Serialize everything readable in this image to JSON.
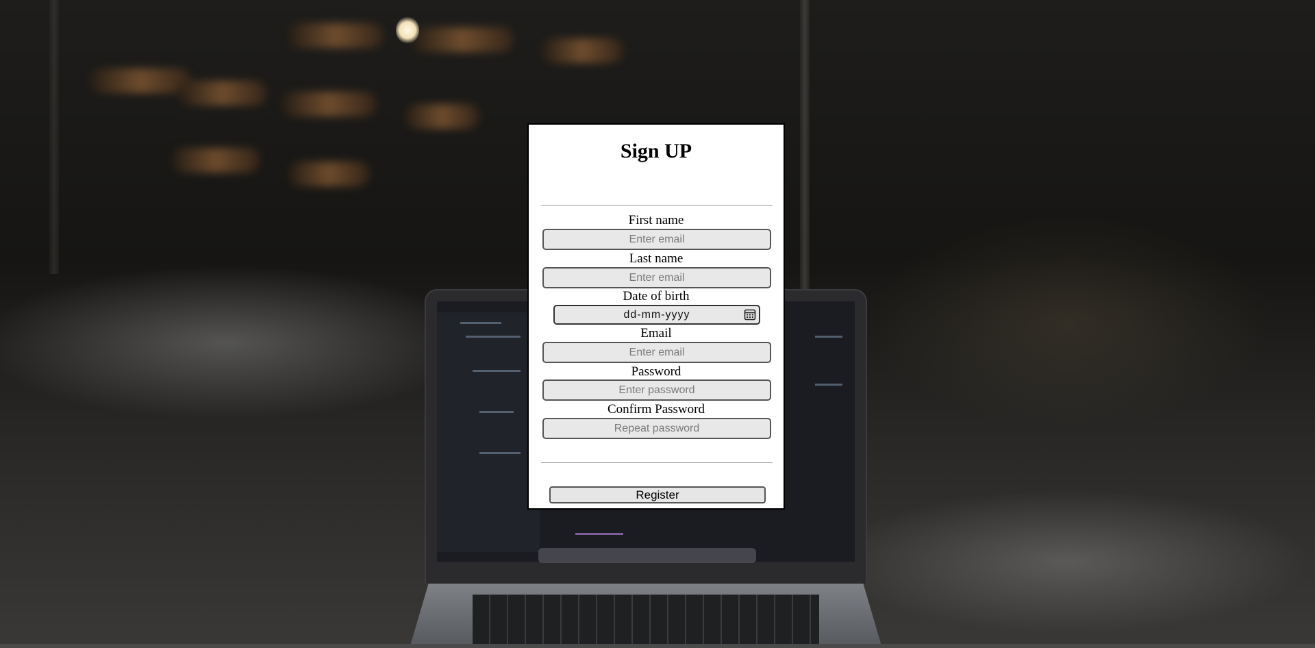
{
  "form": {
    "title": "Sign UP",
    "fields": {
      "first_name": {
        "label": "First name",
        "placeholder": "Enter email"
      },
      "last_name": {
        "label": "Last name",
        "placeholder": "Enter email"
      },
      "date_of_birth": {
        "label": "Date of birth",
        "placeholder": "dd-mm-yyyy",
        "icon": "calendar-icon"
      },
      "email": {
        "label": "Email",
        "placeholder": "Enter email"
      },
      "password": {
        "label": "Password",
        "placeholder": "Enter password"
      },
      "confirm_password": {
        "label": "Confirm Password",
        "placeholder": "Repeat password"
      }
    },
    "register_label": "Register"
  },
  "colors": {
    "card_background": "#ffffff",
    "card_border": "#000000",
    "input_background": "#e8e8e8",
    "input_border": "#555555"
  }
}
